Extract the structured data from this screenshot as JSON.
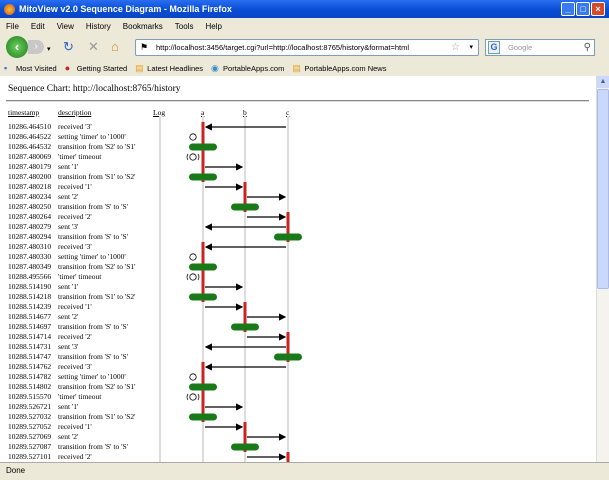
{
  "window": {
    "title": "MitoView v2.0 Sequence Diagram - Mozilla Firefox"
  },
  "menu": [
    "File",
    "Edit",
    "View",
    "History",
    "Bookmarks",
    "Tools",
    "Help"
  ],
  "nav": {
    "url": "http://localhost:3456/target.cgi?url=http://localhost:8765/history&format=html",
    "search_placeholder": "Google"
  },
  "bookmarks": [
    "Most Visited",
    "Getting Started",
    "Latest Headlines",
    "PortableApps.com",
    "PortableApps.com News"
  ],
  "page": {
    "heading": "Sequence Chart: http://localhost:8765/history",
    "col_timestamp": "timestamp",
    "col_description": "description",
    "col_log": "Log",
    "lanes": [
      "a",
      "b",
      "c"
    ]
  },
  "colors": {
    "active": "#cc2222",
    "state": "#1a7a1a",
    "lane": "#dddddd",
    "arrow": "#000000"
  },
  "rows": [
    {
      "ts": "10286.464510",
      "desc": "received '3'",
      "kind": "recv",
      "lane": "a",
      "from": "c"
    },
    {
      "ts": "10286.464522",
      "desc": "setting 'timer' to '1000'",
      "kind": "timer",
      "lane": "a"
    },
    {
      "ts": "10286.464532",
      "desc": "transition from 'S2' to 'S1'",
      "kind": "state",
      "lane": "a"
    },
    {
      "ts": "10287.480069",
      "desc": "'timer' timeout",
      "kind": "timeout",
      "lane": "a"
    },
    {
      "ts": "10287.480179",
      "desc": "sent '1'",
      "kind": "send",
      "lane": "a",
      "to": "b"
    },
    {
      "ts": "10287.480200",
      "desc": "transition from 'S1' to 'S2'",
      "kind": "state",
      "lane": "a"
    },
    {
      "ts": "10287.480218",
      "desc": "received '1'",
      "kind": "recv",
      "lane": "b",
      "from": "a"
    },
    {
      "ts": "10287.480234",
      "desc": "sent '2'",
      "kind": "send",
      "lane": "b",
      "to": "c"
    },
    {
      "ts": "10287.480250",
      "desc": "transition from 'S' to 'S'",
      "kind": "state",
      "lane": "b"
    },
    {
      "ts": "10287.480264",
      "desc": "received '2'",
      "kind": "recv",
      "lane": "c",
      "from": "b"
    },
    {
      "ts": "10287.480279",
      "desc": "sent '3'",
      "kind": "send",
      "lane": "c",
      "to": "a"
    },
    {
      "ts": "10287.480294",
      "desc": "transition from 'S' to 'S'",
      "kind": "state",
      "lane": "c"
    },
    {
      "ts": "10287.480310",
      "desc": "received '3'",
      "kind": "recv",
      "lane": "a",
      "from": "c"
    },
    {
      "ts": "10287.480330",
      "desc": "setting 'timer' to '1000'",
      "kind": "timer",
      "lane": "a"
    },
    {
      "ts": "10287.480349",
      "desc": "transition from 'S2' to 'S1'",
      "kind": "state",
      "lane": "a"
    },
    {
      "ts": "10288.495566",
      "desc": "'timer' timeout",
      "kind": "timeout",
      "lane": "a"
    },
    {
      "ts": "10288.514190",
      "desc": "sent '1'",
      "kind": "send",
      "lane": "a",
      "to": "b"
    },
    {
      "ts": "10288.514218",
      "desc": "transition from 'S1' to 'S2'",
      "kind": "state",
      "lane": "a"
    },
    {
      "ts": "10288.514239",
      "desc": "received '1'",
      "kind": "recv",
      "lane": "b",
      "from": "a"
    },
    {
      "ts": "10288.514677",
      "desc": "sent '2'",
      "kind": "send",
      "lane": "b",
      "to": "c"
    },
    {
      "ts": "10288.514697",
      "desc": "transition from 'S' to 'S'",
      "kind": "state",
      "lane": "b"
    },
    {
      "ts": "10288.514714",
      "desc": "received '2'",
      "kind": "recv",
      "lane": "c",
      "from": "b"
    },
    {
      "ts": "10288.514731",
      "desc": "sent '3'",
      "kind": "send",
      "lane": "c",
      "to": "a"
    },
    {
      "ts": "10288.514747",
      "desc": "transition from 'S' to 'S'",
      "kind": "state",
      "lane": "c"
    },
    {
      "ts": "10288.514762",
      "desc": "received '3'",
      "kind": "recv",
      "lane": "a",
      "from": "c"
    },
    {
      "ts": "10288.514782",
      "desc": "setting 'timer' to '1000'",
      "kind": "timer",
      "lane": "a"
    },
    {
      "ts": "10288.514802",
      "desc": "transition from 'S2' to 'S1'",
      "kind": "state",
      "lane": "a"
    },
    {
      "ts": "10289.515570",
      "desc": "'timer' timeout",
      "kind": "timeout",
      "lane": "a"
    },
    {
      "ts": "10289.526721",
      "desc": "sent '1'",
      "kind": "send",
      "lane": "a",
      "to": "b"
    },
    {
      "ts": "10289.527032",
      "desc": "transition from 'S1' to 'S2'",
      "kind": "state",
      "lane": "a"
    },
    {
      "ts": "10289.527052",
      "desc": "received '1'",
      "kind": "recv",
      "lane": "b",
      "from": "a"
    },
    {
      "ts": "10289.527069",
      "desc": "sent '2'",
      "kind": "send",
      "lane": "b",
      "to": "c"
    },
    {
      "ts": "10289.527087",
      "desc": "transition from 'S' to 'S'",
      "kind": "state",
      "lane": "b"
    },
    {
      "ts": "10289.527101",
      "desc": "received '2'",
      "kind": "recv",
      "lane": "c",
      "from": "b"
    }
  ],
  "status": "Done"
}
